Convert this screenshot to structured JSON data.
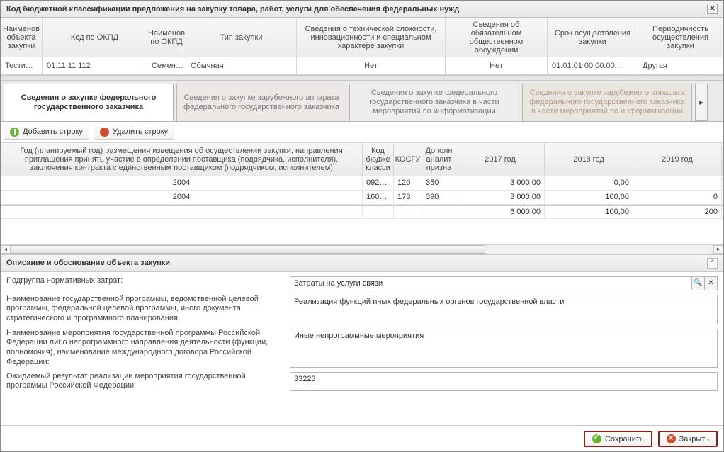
{
  "window": {
    "title": "Код бюджетной классификации предложения на закупку товара, работ, услуги для обеспечения федеральных нужд"
  },
  "header_cols": [
    "Наименов объекта закупки",
    "Код по ОКПД",
    "Наименов по ОКПД",
    "Тип закупки",
    "Сведения о технической сложности, инновационности и специальном характере закупки",
    "Сведения об обязательном общественном обсуждении",
    "Срок осуществления закупки",
    "Периодичность осуществления закупки"
  ],
  "header_vals": [
    "Тести…",
    "01.11.11.112",
    "Семен…",
    "Обычная",
    "Нет",
    "Нет",
    "01.01.01 00:00:00,…",
    "Другая"
  ],
  "tabs": [
    "Сведения о закупке федерального государственного заказчика",
    "Сведения о закупке зарубежного аппарата федерального государственного заказчика",
    "Сведения о закупке федерального государственного заказчика в части мероприятий по информатизации",
    "Сведения о закупке зарубежного аппарата федерального государственного заказчика в части мероприятий по информатизации"
  ],
  "toolbar": {
    "add": "Добавить строку",
    "del": "Удалить строку"
  },
  "grid_cols": [
    "Год (планируемый год) размещения извещения об осуществлении закупки, направления приглашения принять участие в определении поставщика (подрядчика, исполнителя), заключения контракта с единственным поставщиком (подрядчиком, исполнителем)",
    "Код бюдже класси",
    "КОСГУ",
    "Дополн аналит призна",
    "2017 год",
    "2018 год",
    "2019 год"
  ],
  "grid_rows": [
    {
      "year": "2004",
      "k1": "092…",
      "k2": "120",
      "k3": "350",
      "y2017": "3 000,00",
      "y2018": "0,00",
      "y2019": ""
    },
    {
      "year": "2004",
      "k1": "160…",
      "k2": "173",
      "k3": "390",
      "y2017": "3 000,00",
      "y2018": "100,00",
      "y2019": "0"
    }
  ],
  "totals": {
    "y2017": "6 000,00",
    "y2018": "100,00",
    "y2019": "200"
  },
  "section": {
    "title": "Описание и обоснование объекта закупки"
  },
  "form": {
    "f1_label": "Подгруппа нормативных затрат:",
    "f1_value": "Затраты на услуги связи",
    "f2_label": "Наименование государственной программы, ведомственной целевой программы, федеральной целевой программы, иного документа стратегического и программного планирования:",
    "f2_value": "Реализация функций иных федеральных органов государственной власти",
    "f3_label": "Наименование мероприятия государственной программы Российской Федерации либо непрограммного направления деятельности (функции, полномочия), наименование международного договора Российской Федерации:",
    "f3_value": "Иные непрограммные мероприятия",
    "f4_label": "Ожидаемый результат реализации мероприятия государственной программы Российской Федерации:",
    "f4_value": "33223"
  },
  "buttons": {
    "save": "Сохранить",
    "close": "Закрыть"
  }
}
